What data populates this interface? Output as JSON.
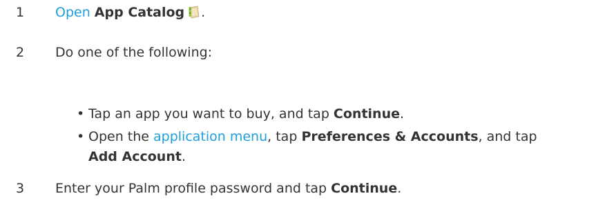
{
  "steps": [
    {
      "number": "1",
      "link": "Open",
      "app": "App Catalog",
      "end": "."
    },
    {
      "number": "2",
      "text": "Do one of the following:"
    },
    {
      "number": "3",
      "text": "Enter your Palm profile password and tap ",
      "bold": "Continue",
      "end": "."
    }
  ],
  "options": [
    {
      "bullet": "•",
      "text1": "Tap an app you want to buy, and tap ",
      "bold1": "Continue",
      "end": "."
    },
    {
      "bullet": "•",
      "text1": "Open the ",
      "link": "application menu",
      "text2": ", tap ",
      "bold1": "Preferences & Accounts",
      "text3": ", and tap ",
      "bold2": "Add Account",
      "end": "."
    }
  ],
  "icons": {
    "app_catalog": "app-catalog-icon"
  },
  "colors": {
    "text": "#333333",
    "link": "#1c9fdc"
  }
}
